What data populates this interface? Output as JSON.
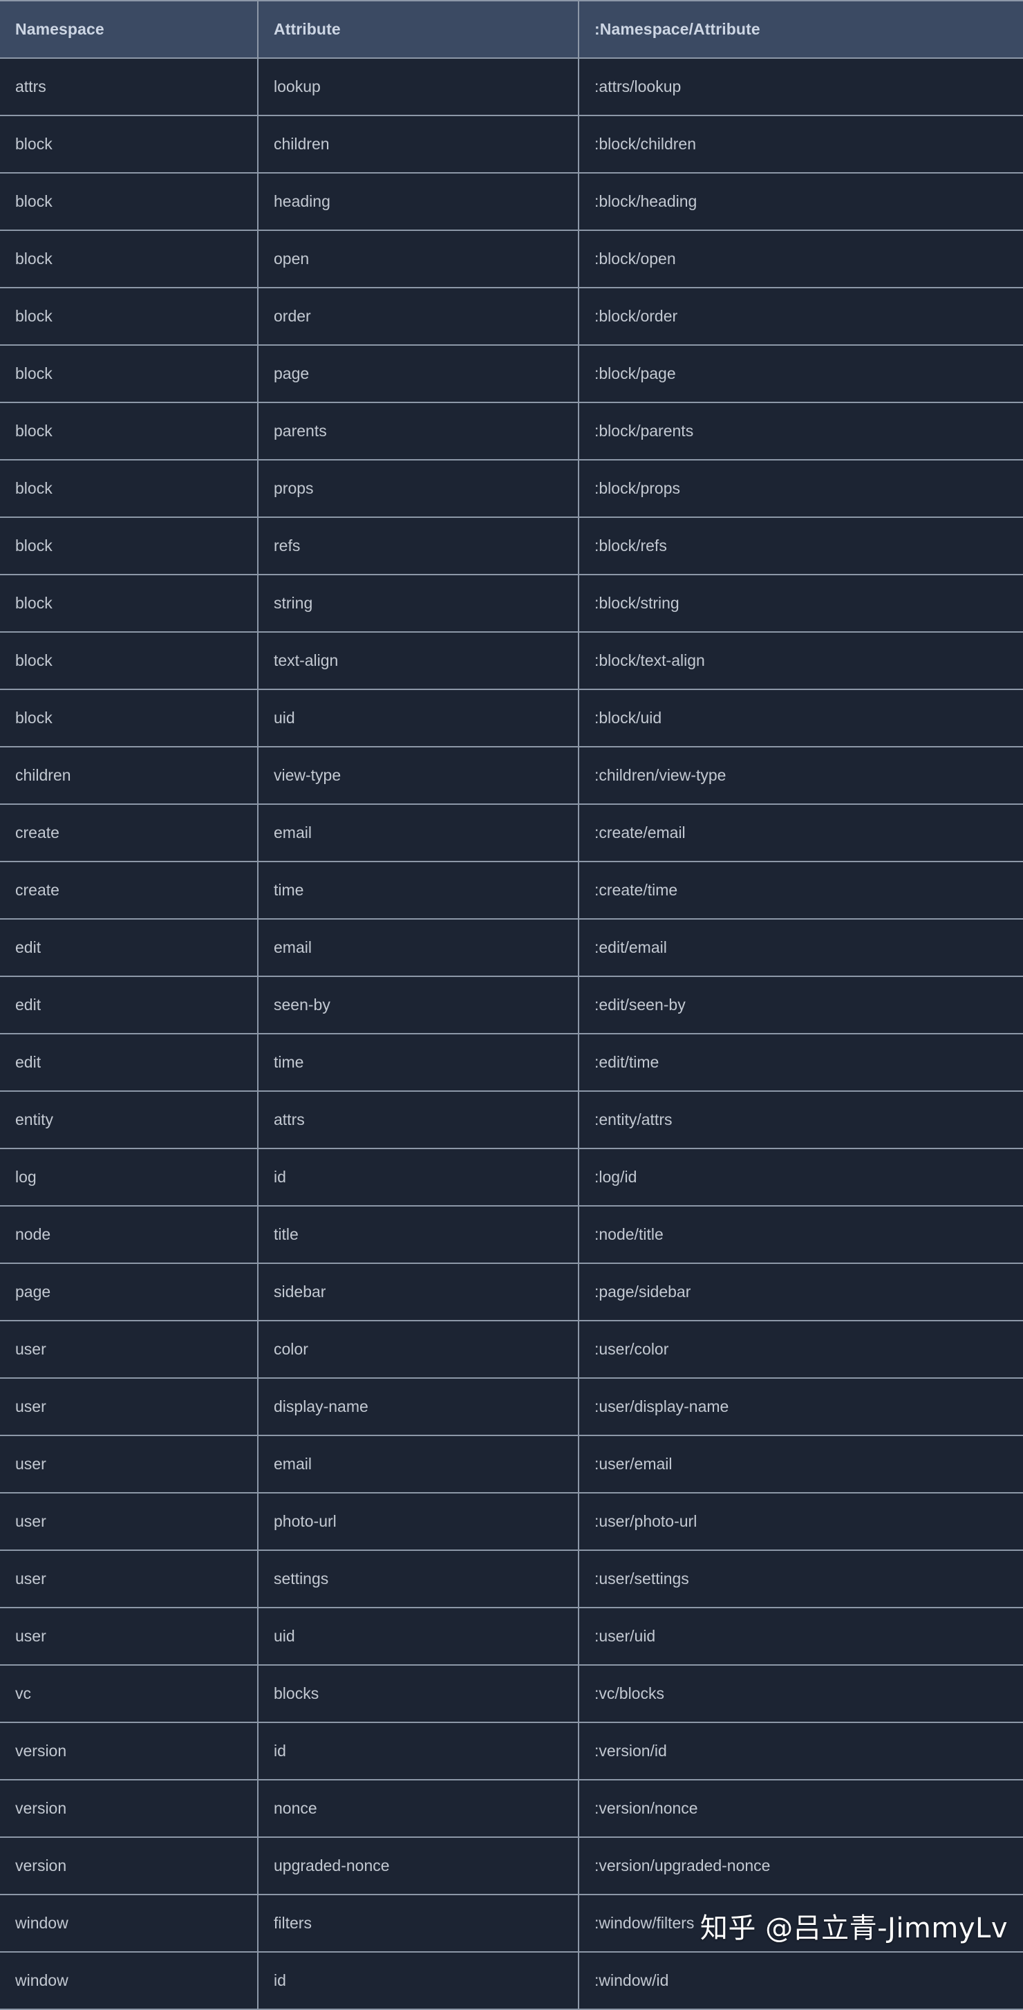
{
  "table": {
    "columns": [
      {
        "key": "namespace",
        "label": "Namespace"
      },
      {
        "key": "attribute",
        "label": "Attribute"
      },
      {
        "key": "qualified",
        "label": ":Namespace/Attribute"
      }
    ],
    "rows": [
      {
        "namespace": "attrs",
        "attribute": "lookup",
        "qualified": ":attrs/lookup"
      },
      {
        "namespace": "block",
        "attribute": "children",
        "qualified": ":block/children"
      },
      {
        "namespace": "block",
        "attribute": "heading",
        "qualified": ":block/heading"
      },
      {
        "namespace": "block",
        "attribute": "open",
        "qualified": ":block/open"
      },
      {
        "namespace": "block",
        "attribute": "order",
        "qualified": ":block/order"
      },
      {
        "namespace": "block",
        "attribute": "page",
        "qualified": ":block/page"
      },
      {
        "namespace": "block",
        "attribute": "parents",
        "qualified": ":block/parents"
      },
      {
        "namespace": "block",
        "attribute": "props",
        "qualified": ":block/props"
      },
      {
        "namespace": "block",
        "attribute": "refs",
        "qualified": ":block/refs"
      },
      {
        "namespace": "block",
        "attribute": "string",
        "qualified": ":block/string"
      },
      {
        "namespace": "block",
        "attribute": "text-align",
        "qualified": ":block/text-align"
      },
      {
        "namespace": "block",
        "attribute": "uid",
        "qualified": ":block/uid"
      },
      {
        "namespace": "children",
        "attribute": "view-type",
        "qualified": ":children/view-type"
      },
      {
        "namespace": "create",
        "attribute": "email",
        "qualified": ":create/email"
      },
      {
        "namespace": "create",
        "attribute": "time",
        "qualified": ":create/time"
      },
      {
        "namespace": "edit",
        "attribute": "email",
        "qualified": ":edit/email"
      },
      {
        "namespace": "edit",
        "attribute": "seen-by",
        "qualified": ":edit/seen-by"
      },
      {
        "namespace": "edit",
        "attribute": "time",
        "qualified": ":edit/time"
      },
      {
        "namespace": "entity",
        "attribute": "attrs",
        "qualified": ":entity/attrs"
      },
      {
        "namespace": "log",
        "attribute": "id",
        "qualified": ":log/id"
      },
      {
        "namespace": "node",
        "attribute": "title",
        "qualified": ":node/title"
      },
      {
        "namespace": "page",
        "attribute": "sidebar",
        "qualified": ":page/sidebar"
      },
      {
        "namespace": "user",
        "attribute": "color",
        "qualified": ":user/color"
      },
      {
        "namespace": "user",
        "attribute": "display-name",
        "qualified": ":user/display-name"
      },
      {
        "namespace": "user",
        "attribute": "email",
        "qualified": ":user/email"
      },
      {
        "namespace": "user",
        "attribute": "photo-url",
        "qualified": ":user/photo-url"
      },
      {
        "namespace": "user",
        "attribute": "settings",
        "qualified": ":user/settings"
      },
      {
        "namespace": "user",
        "attribute": "uid",
        "qualified": ":user/uid"
      },
      {
        "namespace": "vc",
        "attribute": "blocks",
        "qualified": ":vc/blocks"
      },
      {
        "namespace": "version",
        "attribute": "id",
        "qualified": ":version/id"
      },
      {
        "namespace": "version",
        "attribute": "nonce",
        "qualified": ":version/nonce"
      },
      {
        "namespace": "version",
        "attribute": "upgraded-nonce",
        "qualified": ":version/upgraded-nonce"
      },
      {
        "namespace": "window",
        "attribute": "filters",
        "qualified": ":window/filters"
      },
      {
        "namespace": "window",
        "attribute": "id",
        "qualified": ":window/id"
      }
    ]
  },
  "watermark": {
    "text": "知乎 @吕立青-JimmyLv"
  },
  "colors": {
    "header_bg": "#3b4a63",
    "header_text": "#cdd6e4",
    "row_bg": "#1c2433",
    "row_text": "#c3c9d2",
    "border": "#8d98a8",
    "watermark_text": "#ffffff"
  }
}
